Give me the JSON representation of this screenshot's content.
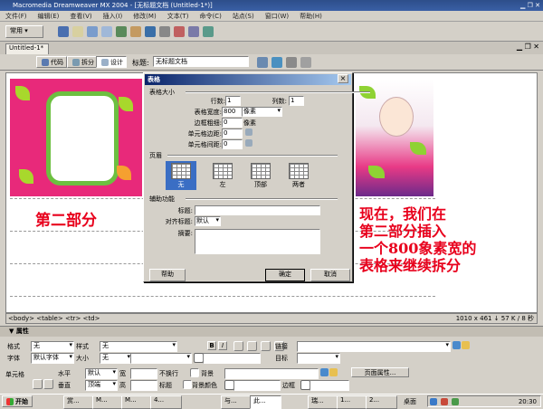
{
  "window": {
    "title": "Macromedia Dreamweaver MX 2004 - [无标题文档 (Untitled-1*)]"
  },
  "menu": [
    "文件(F)",
    "编辑(E)",
    "查看(V)",
    "插入(I)",
    "修改(M)",
    "文本(T)",
    "命令(C)",
    "站点(S)",
    "窗口(W)",
    "帮助(H)"
  ],
  "insert_bar": {
    "category": "常用"
  },
  "document": {
    "tab": "Untitled-1*",
    "view_buttons": [
      "代码",
      "拆分",
      "设计"
    ],
    "title_label": "标题:",
    "title_value": "无标题文档"
  },
  "canvas": {
    "part2_label": "第二部分",
    "note_lines": [
      "现在，我们在",
      "第二部分插入",
      "一个800象素宽的",
      "表格来继续拆分"
    ]
  },
  "tag_bar": {
    "tags": "<body> <table> <tr> <td>",
    "info": "1010 x 461 ↓ 57 K / 8 秒"
  },
  "dialog": {
    "title": "表格",
    "size_section": "表格大小",
    "rows_label": "行数:",
    "rows_value": "1",
    "cols_label": "列数:",
    "cols_value": "1",
    "width_label": "表格宽度:",
    "width_value": "800",
    "width_unit": "像素",
    "border_label": "边框粗细:",
    "border_value": "0",
    "border_unit": "像素",
    "padding_label": "单元格边距:",
    "padding_value": "0",
    "spacing_label": "单元格间距:",
    "spacing_value": "0",
    "header_section": "页眉",
    "header_options": [
      "无",
      "左",
      "顶部",
      "两者"
    ],
    "access_section": "辅助功能",
    "caption_label": "标题:",
    "caption_value": "",
    "align_label": "对齐标题:",
    "align_value": "默认",
    "summary_label": "摘要:",
    "summary_value": "",
    "help": "帮助",
    "ok": "确定",
    "cancel": "取消"
  },
  "properties": {
    "title": "属性",
    "format_label": "格式",
    "format_value": "无",
    "style_label": "样式",
    "style_value": "无",
    "font_label": "字体",
    "font_value": "默认字体",
    "size_label": "大小",
    "size_value": "无",
    "link_label": "链接",
    "target_label": "目标",
    "cell_label": "单元格",
    "h_label": "水平",
    "h_value": "默认",
    "w_label": "宽",
    "nowrap_label": "不换行",
    "bg_label": "背景",
    "page_props": "页面属性...",
    "v_label": "垂直",
    "v_value": "顶端",
    "height_label": "高",
    "header_label": "标题",
    "bgcolor_label": "背景颜色",
    "border_label": "边框"
  },
  "taskbar": {
    "start": "开始",
    "tasks": [
      "赏...",
      "M...",
      "M...",
      "4...",
      "与...",
      "此...",
      "瑞...",
      "1...",
      "2..."
    ],
    "tray_label": "桌面",
    "clock": "20:30"
  },
  "colors": {
    "note_red": "#e8001c",
    "pink": "#e8297a",
    "leaf_green": "#8fd233",
    "dialog_title": "#0a246a"
  }
}
